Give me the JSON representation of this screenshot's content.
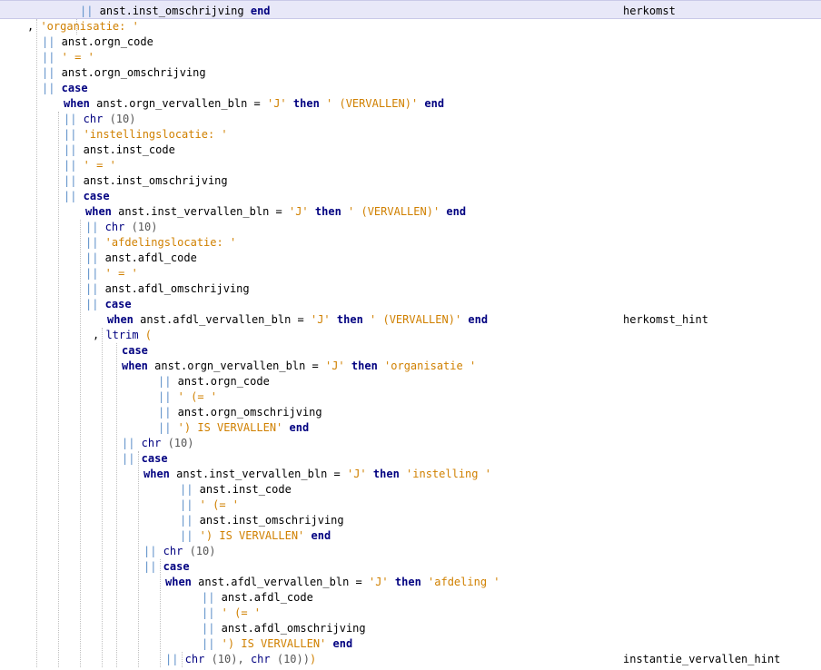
{
  "colors": {
    "keyword": "#000080",
    "string": "#d08000",
    "operator": "#5c8fc8",
    "identifier": "#000000",
    "current_line": "#e8e8f8"
  },
  "lines": [
    {
      "indent": 88,
      "current": true,
      "tokens": [
        [
          "pipe",
          "||"
        ],
        [
          "id",
          " anst.inst_omschrijving "
        ],
        [
          "kw",
          "end"
        ]
      ],
      "alias": "herkomst"
    },
    {
      "indent": 30,
      "tokens": [
        [
          "punct",
          ", "
        ],
        [
          "str",
          "'organisatie: '"
        ]
      ]
    },
    {
      "indent": 46,
      "tokens": [
        [
          "pipe",
          "||"
        ],
        [
          "id",
          " anst.orgn_code"
        ]
      ]
    },
    {
      "indent": 46,
      "tokens": [
        [
          "pipe",
          "||"
        ],
        [
          "str",
          " ' = '"
        ]
      ]
    },
    {
      "indent": 46,
      "tokens": [
        [
          "pipe",
          "||"
        ],
        [
          "id",
          " anst.orgn_omschrijving"
        ]
      ]
    },
    {
      "indent": 46,
      "tokens": [
        [
          "pipe",
          "||"
        ],
        [
          "kw",
          " case"
        ]
      ]
    },
    {
      "indent": 70,
      "tokens": [
        [
          "kw",
          "when"
        ],
        [
          "id",
          " anst.orgn_vervallen_bln = "
        ],
        [
          "str",
          "'J'"
        ],
        [
          "kw",
          " then"
        ],
        [
          "str",
          " ' (VERVALLEN)'"
        ],
        [
          "kw",
          " end"
        ]
      ]
    },
    {
      "indent": 70,
      "tokens": [
        [
          "pipe",
          "||"
        ],
        [
          "fn",
          " chr"
        ],
        [
          "num",
          " (10)"
        ]
      ]
    },
    {
      "indent": 70,
      "tokens": [
        [
          "pipe",
          "||"
        ],
        [
          "str",
          " 'instellingslocatie: '"
        ]
      ]
    },
    {
      "indent": 70,
      "tokens": [
        [
          "pipe",
          "||"
        ],
        [
          "id",
          " anst.inst_code"
        ]
      ]
    },
    {
      "indent": 70,
      "tokens": [
        [
          "pipe",
          "||"
        ],
        [
          "str",
          " ' = '"
        ]
      ]
    },
    {
      "indent": 70,
      "tokens": [
        [
          "pipe",
          "||"
        ],
        [
          "id",
          " anst.inst_omschrijving"
        ]
      ]
    },
    {
      "indent": 70,
      "tokens": [
        [
          "pipe",
          "||"
        ],
        [
          "kw",
          " case"
        ]
      ]
    },
    {
      "indent": 94,
      "tokens": [
        [
          "kw",
          "when"
        ],
        [
          "id",
          " anst.inst_vervallen_bln = "
        ],
        [
          "str",
          "'J'"
        ],
        [
          "kw",
          " then"
        ],
        [
          "str",
          " ' (VERVALLEN)'"
        ],
        [
          "kw",
          " end"
        ]
      ]
    },
    {
      "indent": 94,
      "tokens": [
        [
          "pipe",
          "||"
        ],
        [
          "fn",
          " chr"
        ],
        [
          "num",
          " (10)"
        ]
      ]
    },
    {
      "indent": 94,
      "tokens": [
        [
          "pipe",
          "||"
        ],
        [
          "str",
          " 'afdelingslocatie: '"
        ]
      ]
    },
    {
      "indent": 94,
      "tokens": [
        [
          "pipe",
          "||"
        ],
        [
          "id",
          " anst.afdl_code"
        ]
      ]
    },
    {
      "indent": 94,
      "tokens": [
        [
          "pipe",
          "||"
        ],
        [
          "str",
          " ' = '"
        ]
      ]
    },
    {
      "indent": 94,
      "tokens": [
        [
          "pipe",
          "||"
        ],
        [
          "id",
          " anst.afdl_omschrijving"
        ]
      ]
    },
    {
      "indent": 94,
      "tokens": [
        [
          "pipe",
          "||"
        ],
        [
          "kw",
          " case"
        ]
      ]
    },
    {
      "indent": 118,
      "tokens": [
        [
          "kw",
          "when"
        ],
        [
          "id",
          " anst.afdl_vervallen_bln = "
        ],
        [
          "str",
          "'J'"
        ],
        [
          "kw",
          " then"
        ],
        [
          "str",
          " ' (VERVALLEN)'"
        ],
        [
          "kw",
          " end"
        ]
      ],
      "alias": "herkomst_hint"
    },
    {
      "indent": 102,
      "tokens": [
        [
          "punct",
          ", "
        ],
        [
          "fn",
          "ltrim"
        ],
        [
          "str",
          " ("
        ]
      ]
    },
    {
      "indent": 134,
      "tokens": [
        [
          "kw",
          "case"
        ]
      ]
    },
    {
      "indent": 134,
      "tokens": [
        [
          "kw",
          "when"
        ],
        [
          "id",
          " anst.orgn_vervallen_bln = "
        ],
        [
          "str",
          "'J'"
        ],
        [
          "kw",
          " then"
        ],
        [
          "str",
          " 'organisatie '"
        ]
      ]
    },
    {
      "indent": 174,
      "tokens": [
        [
          "pipe",
          "||"
        ],
        [
          "id",
          " anst.orgn_code"
        ]
      ]
    },
    {
      "indent": 174,
      "tokens": [
        [
          "pipe",
          "||"
        ],
        [
          "str",
          " ' (= '"
        ]
      ]
    },
    {
      "indent": 174,
      "tokens": [
        [
          "pipe",
          "||"
        ],
        [
          "id",
          " anst.orgn_omschrijving"
        ]
      ]
    },
    {
      "indent": 174,
      "tokens": [
        [
          "pipe",
          "||"
        ],
        [
          "str",
          " ') IS VERVALLEN'"
        ],
        [
          "kw",
          " end"
        ]
      ]
    },
    {
      "indent": 134,
      "tokens": [
        [
          "pipe",
          "||"
        ],
        [
          "fn",
          " chr"
        ],
        [
          "num",
          " (10)"
        ]
      ]
    },
    {
      "indent": 134,
      "tokens": [
        [
          "pipe",
          "||"
        ],
        [
          "kw",
          " case"
        ]
      ]
    },
    {
      "indent": 158,
      "tokens": [
        [
          "kw",
          "when"
        ],
        [
          "id",
          " anst.inst_vervallen_bln = "
        ],
        [
          "str",
          "'J'"
        ],
        [
          "kw",
          " then"
        ],
        [
          "str",
          " 'instelling '"
        ]
      ]
    },
    {
      "indent": 198,
      "tokens": [
        [
          "pipe",
          "||"
        ],
        [
          "id",
          " anst.inst_code"
        ]
      ]
    },
    {
      "indent": 198,
      "tokens": [
        [
          "pipe",
          "||"
        ],
        [
          "str",
          " ' (= '"
        ]
      ]
    },
    {
      "indent": 198,
      "tokens": [
        [
          "pipe",
          "||"
        ],
        [
          "id",
          " anst.inst_omschrijving"
        ]
      ]
    },
    {
      "indent": 198,
      "tokens": [
        [
          "pipe",
          "||"
        ],
        [
          "str",
          " ') IS VERVALLEN'"
        ],
        [
          "kw",
          " end"
        ]
      ]
    },
    {
      "indent": 158,
      "tokens": [
        [
          "pipe",
          "||"
        ],
        [
          "fn",
          " chr"
        ],
        [
          "num",
          " (10)"
        ]
      ]
    },
    {
      "indent": 158,
      "tokens": [
        [
          "pipe",
          "||"
        ],
        [
          "kw",
          " case"
        ]
      ]
    },
    {
      "indent": 182,
      "tokens": [
        [
          "kw",
          "when"
        ],
        [
          "id",
          " anst.afdl_vervallen_bln = "
        ],
        [
          "str",
          "'J'"
        ],
        [
          "kw",
          " then"
        ],
        [
          "str",
          " 'afdeling '"
        ]
      ]
    },
    {
      "indent": 222,
      "tokens": [
        [
          "pipe",
          "||"
        ],
        [
          "id",
          " anst.afdl_code"
        ]
      ]
    },
    {
      "indent": 222,
      "tokens": [
        [
          "pipe",
          "||"
        ],
        [
          "str",
          " ' (= '"
        ]
      ]
    },
    {
      "indent": 222,
      "tokens": [
        [
          "pipe",
          "||"
        ],
        [
          "id",
          " anst.afdl_omschrijving"
        ]
      ]
    },
    {
      "indent": 222,
      "tokens": [
        [
          "pipe",
          "||"
        ],
        [
          "str",
          " ') IS VERVALLEN'"
        ],
        [
          "kw",
          " end"
        ]
      ]
    },
    {
      "indent": 182,
      "tokens": [
        [
          "pipe",
          "||"
        ],
        [
          "fn",
          " chr"
        ],
        [
          "num",
          " (10),"
        ],
        [
          "fn",
          " chr"
        ],
        [
          "num",
          " (10))"
        ],
        [
          "str",
          ")"
        ]
      ],
      "alias": "instantie_vervallen_hint"
    }
  ]
}
